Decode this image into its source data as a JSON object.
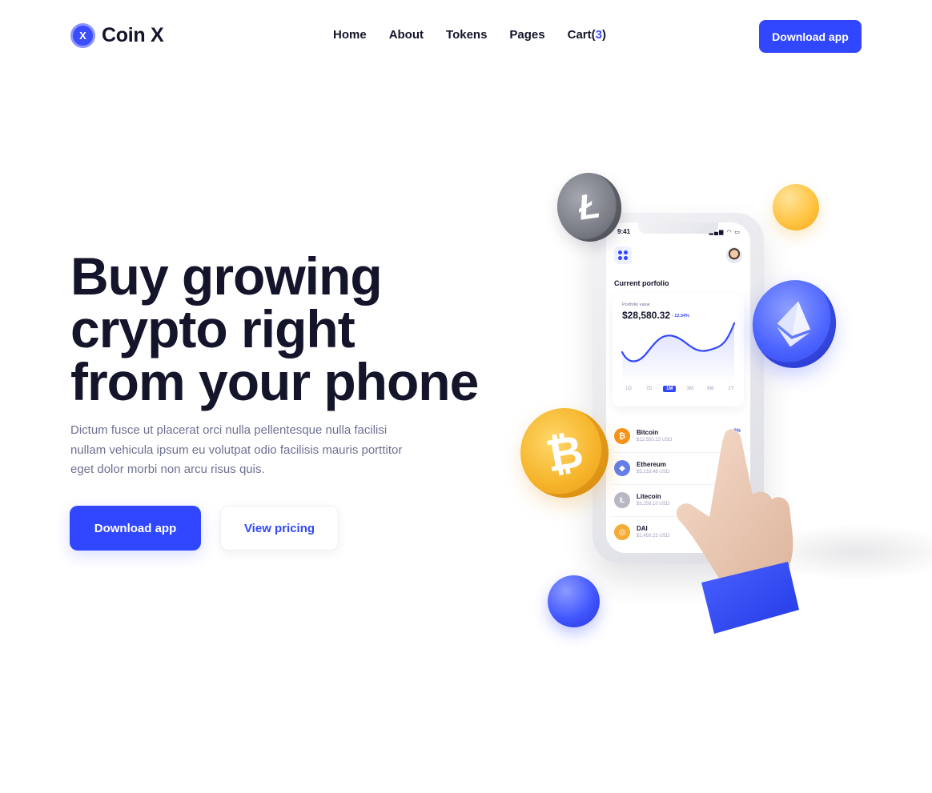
{
  "brand": {
    "logo_letter": "X",
    "name": "Coin X",
    "accent_color": "#3147ff"
  },
  "nav": {
    "items": [
      "Home",
      "About",
      "Tokens",
      "Pages"
    ],
    "cart_label": "Cart(",
    "cart_count": "3",
    "cart_close": ")"
  },
  "header": {
    "download_label": "Download app"
  },
  "hero": {
    "title_lines": [
      "Buy growing",
      "crypto right",
      "from your phone"
    ],
    "description": "Dictum fusce ut placerat orci nulla pellentesque nulla facilisi nullam vehicula ipsum eu volutpat odio facilisis mauris porttitor eget dolor morbi non arcu risus quis.",
    "primary_label": "Download app",
    "secondary_label": "View pricing"
  },
  "phone": {
    "time": "9:41",
    "status_icons": "signal-wifi-battery",
    "portfolio_heading": "Current porfolio",
    "portfolio_value_label": "Portfolio value",
    "portfolio_value": "$28,580.32",
    "portfolio_change": "↑ 12.34%",
    "periods": [
      "1D",
      "7D",
      "1M",
      "3M",
      "6M",
      "1Y"
    ],
    "active_period": "1M",
    "coins": [
      {
        "name": "Bitcoin",
        "usd": "$12,550.23 USD",
        "pct": "↑ 3%",
        "color": "#f7931a",
        "icon": "bitcoin-icon",
        "glyph": "₿"
      },
      {
        "name": "Ethereum",
        "usd": "$5,218.48 USD",
        "pct": "↑",
        "color": "#627eea",
        "icon": "ethereum-icon",
        "glyph": "◆"
      },
      {
        "name": "Litecoin",
        "usd": "$3,258.10 USD",
        "pct": "",
        "color": "#b8b8c2",
        "icon": "litecoin-icon",
        "glyph": "Ł"
      },
      {
        "name": "DAI",
        "usd": "$1,450.23 USD",
        "pct": "",
        "color": "#f5ac37",
        "icon": "dai-icon",
        "glyph": "◎"
      }
    ]
  },
  "illustration": {
    "ltc_glyph": "Ł",
    "btc_glyph": "₿"
  }
}
